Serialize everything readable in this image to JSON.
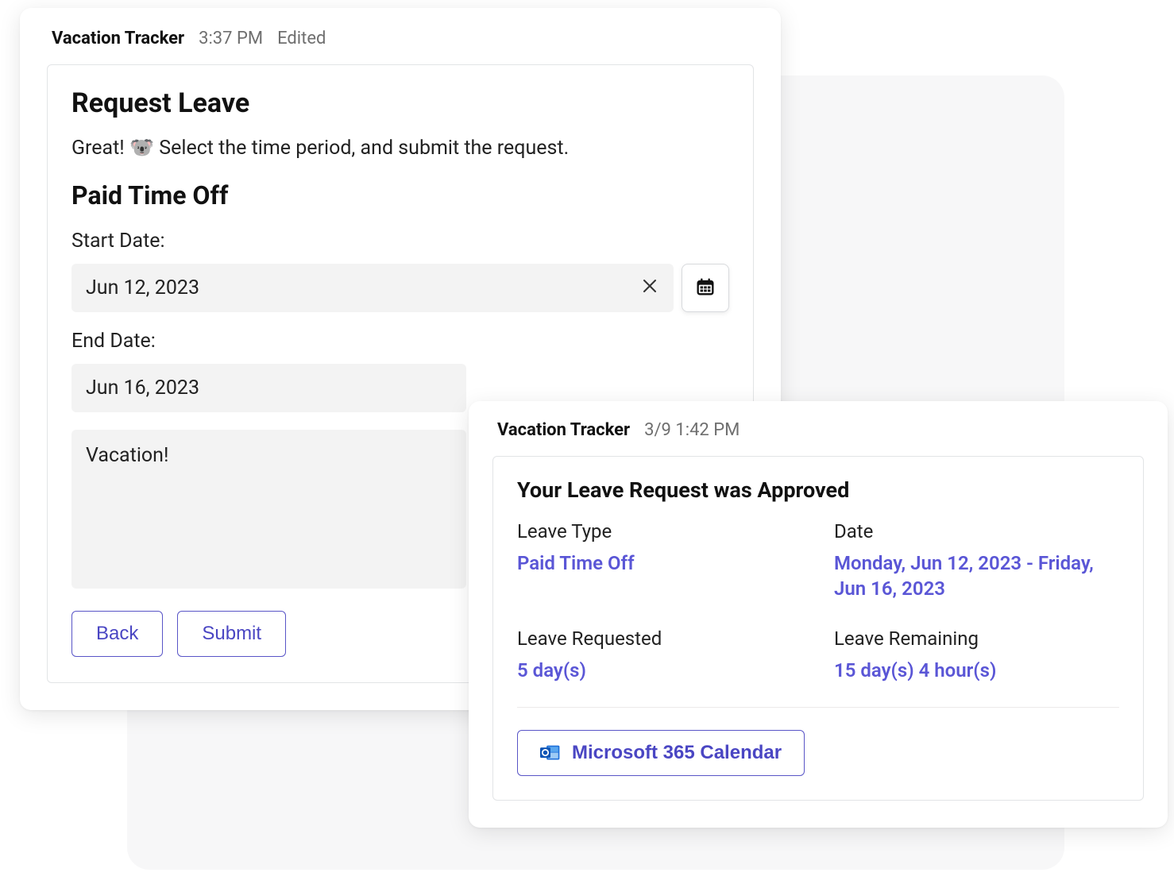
{
  "request_card": {
    "sender": "Vacation Tracker",
    "time": "3:37 PM",
    "edited": "Edited",
    "title": "Request Leave",
    "intro": "Great! 🐨 Select the time period, and submit the request.",
    "leave_type_heading": "Paid Time Off",
    "start_label": "Start Date:",
    "start_value": "Jun 12, 2023",
    "end_label": "End Date:",
    "end_value": "Jun 16, 2023",
    "note_value": "Vacation!",
    "back_label": "Back",
    "submit_label": "Submit"
  },
  "approved_card": {
    "sender": "Vacation Tracker",
    "time": "3/9 1:42 PM",
    "title": "Your Leave Request was Approved",
    "leave_type_label": "Leave Type",
    "leave_type_value": "Paid Time Off",
    "date_label": "Date",
    "date_value": "Monday, Jun 12, 2023 - Friday, Jun 16, 2023",
    "requested_label": "Leave Requested",
    "requested_value": "5 day(s)",
    "remaining_label": "Leave Remaining",
    "remaining_value": "15 day(s) 4 hour(s)",
    "calendar_button": "Microsoft 365 Calendar"
  }
}
